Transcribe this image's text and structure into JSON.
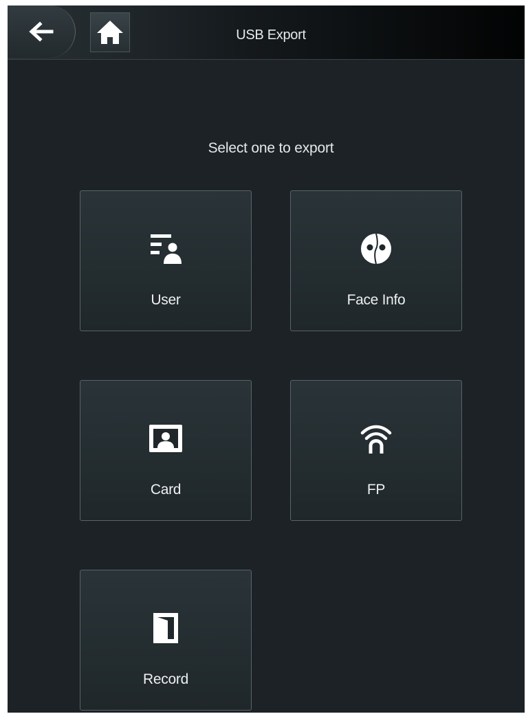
{
  "header": {
    "title": "USB Export",
    "back_icon": "arrow-left-icon",
    "home_icon": "home-icon"
  },
  "prompt": "Select one to export",
  "options": [
    {
      "label": "User",
      "icon": "user-list-icon"
    },
    {
      "label": "Face Info",
      "icon": "face-icon"
    },
    {
      "label": "Card",
      "icon": "card-icon"
    },
    {
      "label": "FP",
      "icon": "fingerprint-icon"
    },
    {
      "label": "Record",
      "icon": "door-record-icon"
    }
  ],
  "colors": {
    "background": "#1c2226",
    "tile_border": "#5a6569",
    "text": "#eef0f1"
  }
}
